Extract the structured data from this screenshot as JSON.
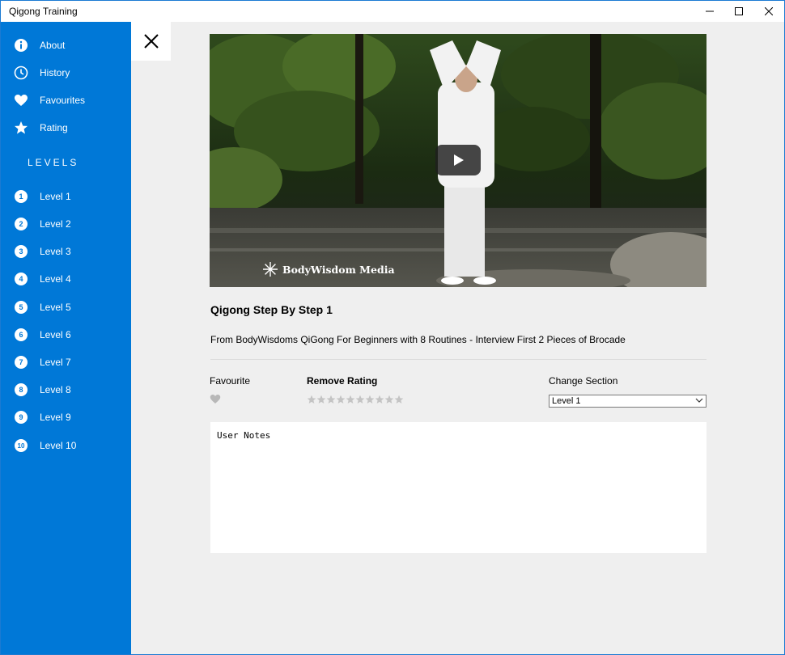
{
  "window": {
    "title": "Qigong Training",
    "minimize_icon": "minimize-icon",
    "maximize_icon": "maximize-icon",
    "close_icon": "close-icon"
  },
  "sidebar": {
    "background": "#0078d7",
    "items": [
      {
        "label": "About",
        "icon": "info-icon"
      },
      {
        "label": "History",
        "icon": "clock-icon"
      },
      {
        "label": "Favourites",
        "icon": "heart-icon"
      },
      {
        "label": "Rating",
        "icon": "star-icon"
      }
    ],
    "levels_heading": "LEVELS",
    "levels": [
      {
        "num": "1",
        "label": "Level 1"
      },
      {
        "num": "2",
        "label": "Level 2"
      },
      {
        "num": "3",
        "label": "Level 3"
      },
      {
        "num": "4",
        "label": "Level 4"
      },
      {
        "num": "5",
        "label": "Level 5"
      },
      {
        "num": "6",
        "label": "Level 6"
      },
      {
        "num": "7",
        "label": "Level 7"
      },
      {
        "num": "8",
        "label": "Level 8"
      },
      {
        "num": "9",
        "label": "Level 9"
      },
      {
        "num": "10",
        "label": "Level 10"
      }
    ]
  },
  "detail": {
    "close_icon": "close-x-icon",
    "video": {
      "play_icon": "play-icon",
      "watermark": "BodyWisdom Media"
    },
    "title": "Qigong Step By Step 1",
    "description": "From BodyWisdoms QiGong For Beginners with 8 Routines - Interview First 2 Pieces of Brocade",
    "favourite_label": "Favourite",
    "favourite_icon": "heart-icon",
    "rating_label": "Remove Rating",
    "rating_value": 0,
    "rating_max": 10,
    "change_section_label": "Change Section",
    "section_selected": "Level 1",
    "notes_placeholder": "User Notes"
  }
}
